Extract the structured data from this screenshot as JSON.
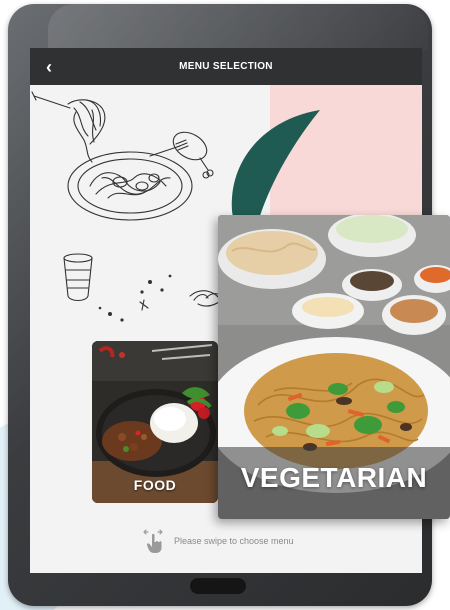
{
  "header": {
    "title": "MENU SELECTION",
    "back_icon": "chevron-left-icon",
    "back_glyph": "‹"
  },
  "cards": [
    {
      "label": "FOOD"
    },
    {
      "label": "VEGETARIAN"
    }
  ],
  "hint": {
    "text": "Please swipe to choose menu",
    "icon": "swipe-hand-icon"
  },
  "colors": {
    "topbar": "#2f3133",
    "pink_accent": "#f8d9d7",
    "green_accent": "#1f5b52",
    "screen_bg": "#f3f3f3"
  }
}
